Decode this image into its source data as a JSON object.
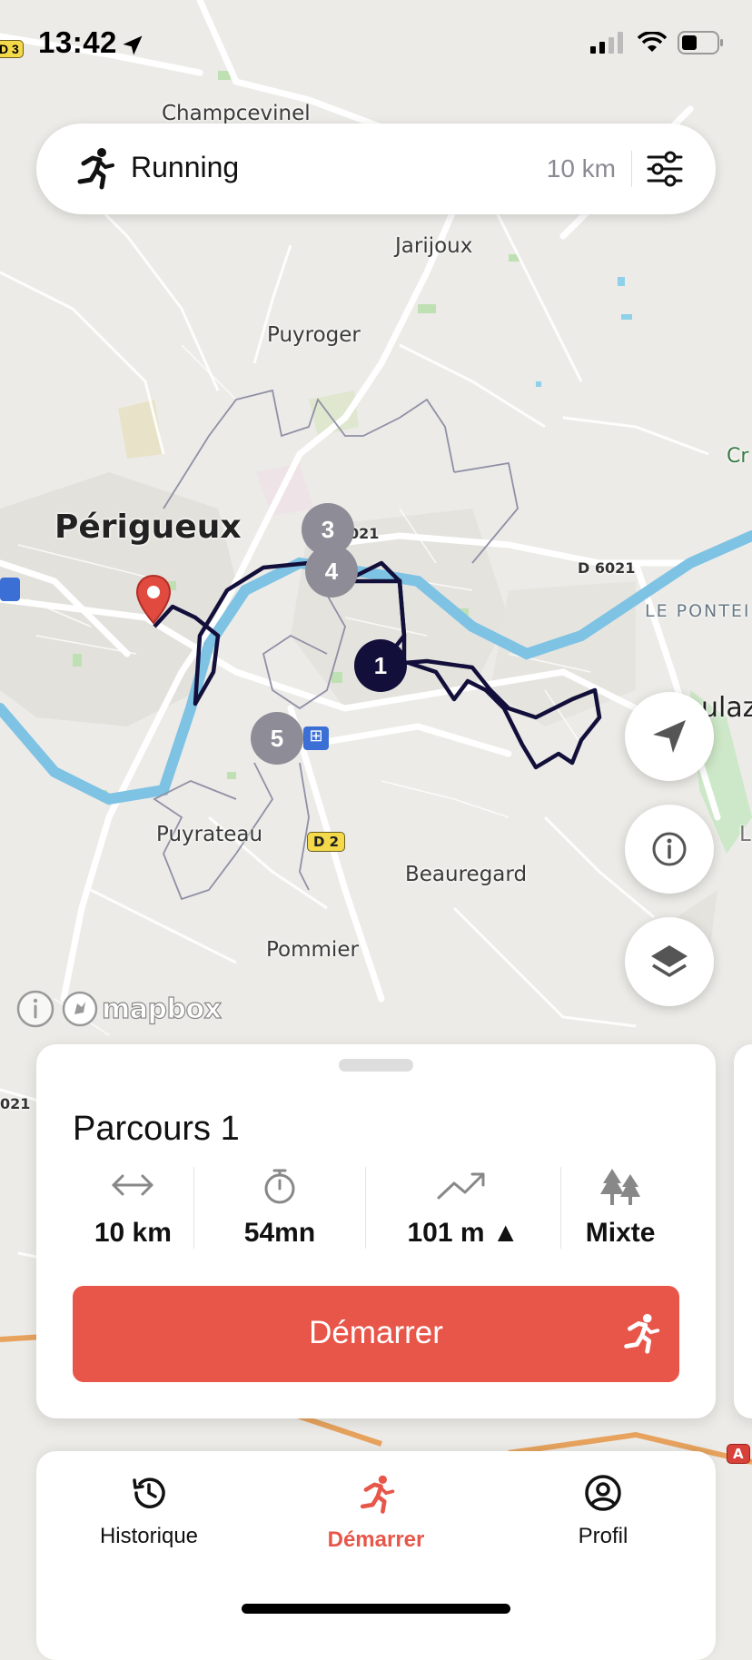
{
  "status_bar": {
    "time": "13:42",
    "left_shield": "D 3",
    "icons": [
      "location-arrow-icon",
      "cellular-signal-icon",
      "wifi-icon",
      "battery-icon"
    ]
  },
  "search_pill": {
    "activity": "Running",
    "distance": "10 km",
    "activity_icon": "runner-icon",
    "filter_icon": "sliders-icon"
  },
  "map": {
    "places": {
      "champcevinel": "Champcevinel",
      "jarijoux": "Jarijoux",
      "puyroger": "Puyroger",
      "perigueux": "Périgueux",
      "puyrateau": "Puyrateau",
      "beauregard": "Beauregard",
      "pommier": "Pommier",
      "le_ponteix": "LE PONTEI",
      "boulazac": "ulaz",
      "cr": "Cr",
      "l": "L"
    },
    "roads": {
      "d6021_a": "021",
      "d6021_b": "D 6021",
      "d2": "D 2",
      "d21_left": "021",
      "a89": "A"
    },
    "markers": [
      "1",
      "3",
      "4",
      "5"
    ],
    "attribution": "mapbox"
  },
  "map_buttons": {
    "locate_icon": "navigation-arrow-icon",
    "info_icon": "info-icon",
    "layers_icon": "layers-icon"
  },
  "route_card": {
    "title": "Parcours 1",
    "stats": {
      "distance": "10 km",
      "duration": "54mn",
      "elevation": "101 m",
      "terrain": "Mixte"
    },
    "start_label": "Démarrer"
  },
  "tab_bar": {
    "tabs": [
      {
        "label": "Historique",
        "icon": "history-icon"
      },
      {
        "label": "Démarrer",
        "icon": "runner-icon"
      },
      {
        "label": "Profil",
        "icon": "profile-icon"
      }
    ],
    "active_tab": 1
  },
  "colors": {
    "accent": "#e8564a",
    "route": "#120f3a",
    "marker_gray": "#8e8c96",
    "water": "#7ec3e4"
  }
}
